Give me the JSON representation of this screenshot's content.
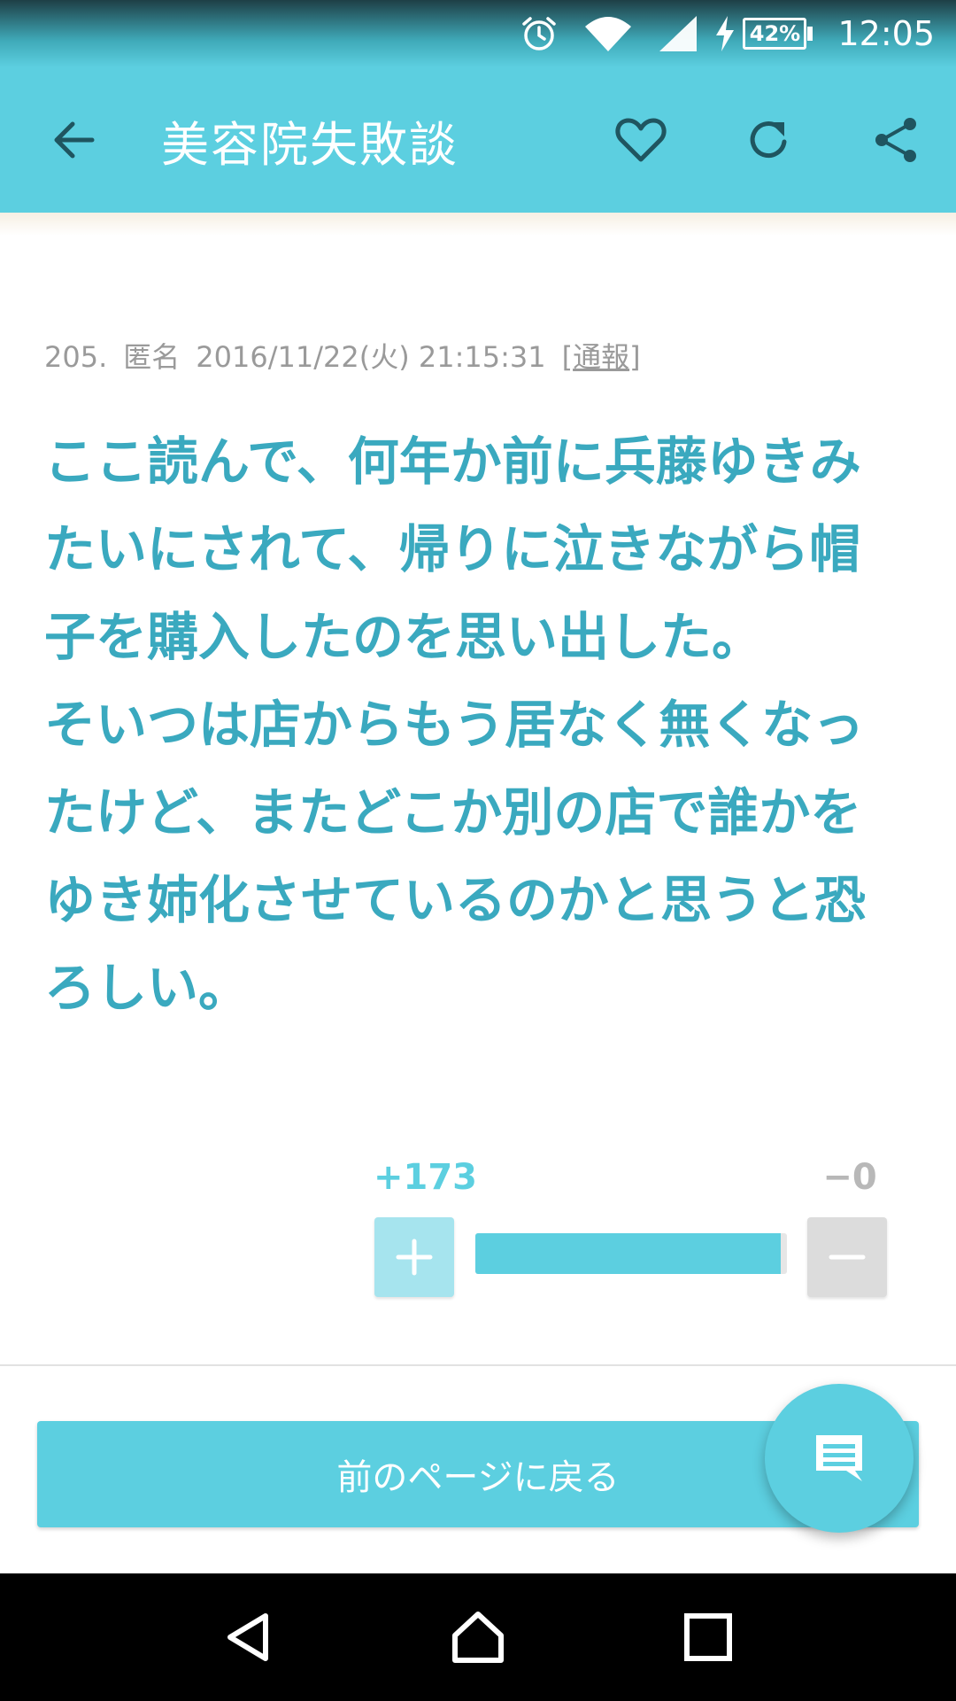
{
  "status_bar": {
    "battery_percent": "42%",
    "time": "12:05",
    "icons": [
      "alarm-icon",
      "wifi-icon",
      "signal-icon",
      "charging-icon",
      "battery-icon"
    ]
  },
  "app_bar": {
    "title": "美容院失敗談",
    "icons": [
      "back-arrow-icon",
      "heart-icon",
      "refresh-icon",
      "share-icon"
    ]
  },
  "post": {
    "number": "205.",
    "author": "匿名",
    "datetime": "2016/11/22(火) 21:15:31",
    "report_open": "[",
    "report_label": "通報",
    "report_close": "]",
    "body": "ここ読んで、何年か前に兵藤ゆきみたいにされて、帰りに泣きながら帽子を購入したのを思い出した。\nそいつは店からもう居なく無くなったけど、またどこか別の店で誰かをゆき姉化させているのかと思うと恐ろしい。"
  },
  "votes": {
    "plus_count": "+173",
    "minus_count": "−0",
    "plus_ratio": 0.98,
    "colors": {
      "accent": "#5ccfe0",
      "text_accent": "#3aa9bf"
    }
  },
  "footer": {
    "back_page_label": "前のページに戻る",
    "fab_icon": "comment-icon"
  },
  "nav_bar": {
    "icons": [
      "nav-back-icon",
      "nav-home-icon",
      "nav-recents-icon"
    ]
  }
}
